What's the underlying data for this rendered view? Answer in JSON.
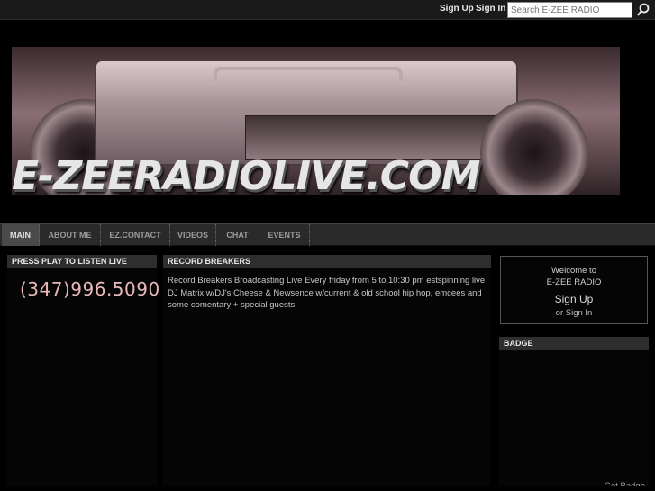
{
  "topbar": {
    "signup_label": "Sign Up",
    "signin_label": "Sign In",
    "search_placeholder": "Search E-ZEE RADIO",
    "search_icon": "search-icon"
  },
  "banner": {
    "logo_text": "E-ZEERADIOLIVE.COM"
  },
  "nav": {
    "tabs": [
      {
        "label": "MAIN",
        "active": true
      },
      {
        "label": "ABOUT ME"
      },
      {
        "label": "EZ.CONTACT"
      },
      {
        "label": "VIDEOS"
      },
      {
        "label": "CHAT"
      },
      {
        "label": "EVENTS"
      }
    ]
  },
  "left_panel": {
    "title": "PRESS PLAY TO LISTEN LIVE",
    "phone": "(347)996.5090"
  },
  "center_panel": {
    "title": "RECORD BREAKERS",
    "body": "Record Breakers Broadcasting Live Every friday from 5 to 10:30 pm estspinning live DJ Matrix w/DJ's Cheese & Newsence w/current & old school hip hop, emcees and some comentary + special guests."
  },
  "welcome": {
    "line1": "Welcome to",
    "line2": "E-ZEE RADIO",
    "signup": "Sign Up",
    "signin": "or Sign In"
  },
  "badge_panel": {
    "title": "BADGE",
    "get_badge": "Get Badge"
  },
  "colors": {
    "background": "#000000",
    "tab_active": "#4a4a4a",
    "phone_text": "#e9b8b8"
  }
}
